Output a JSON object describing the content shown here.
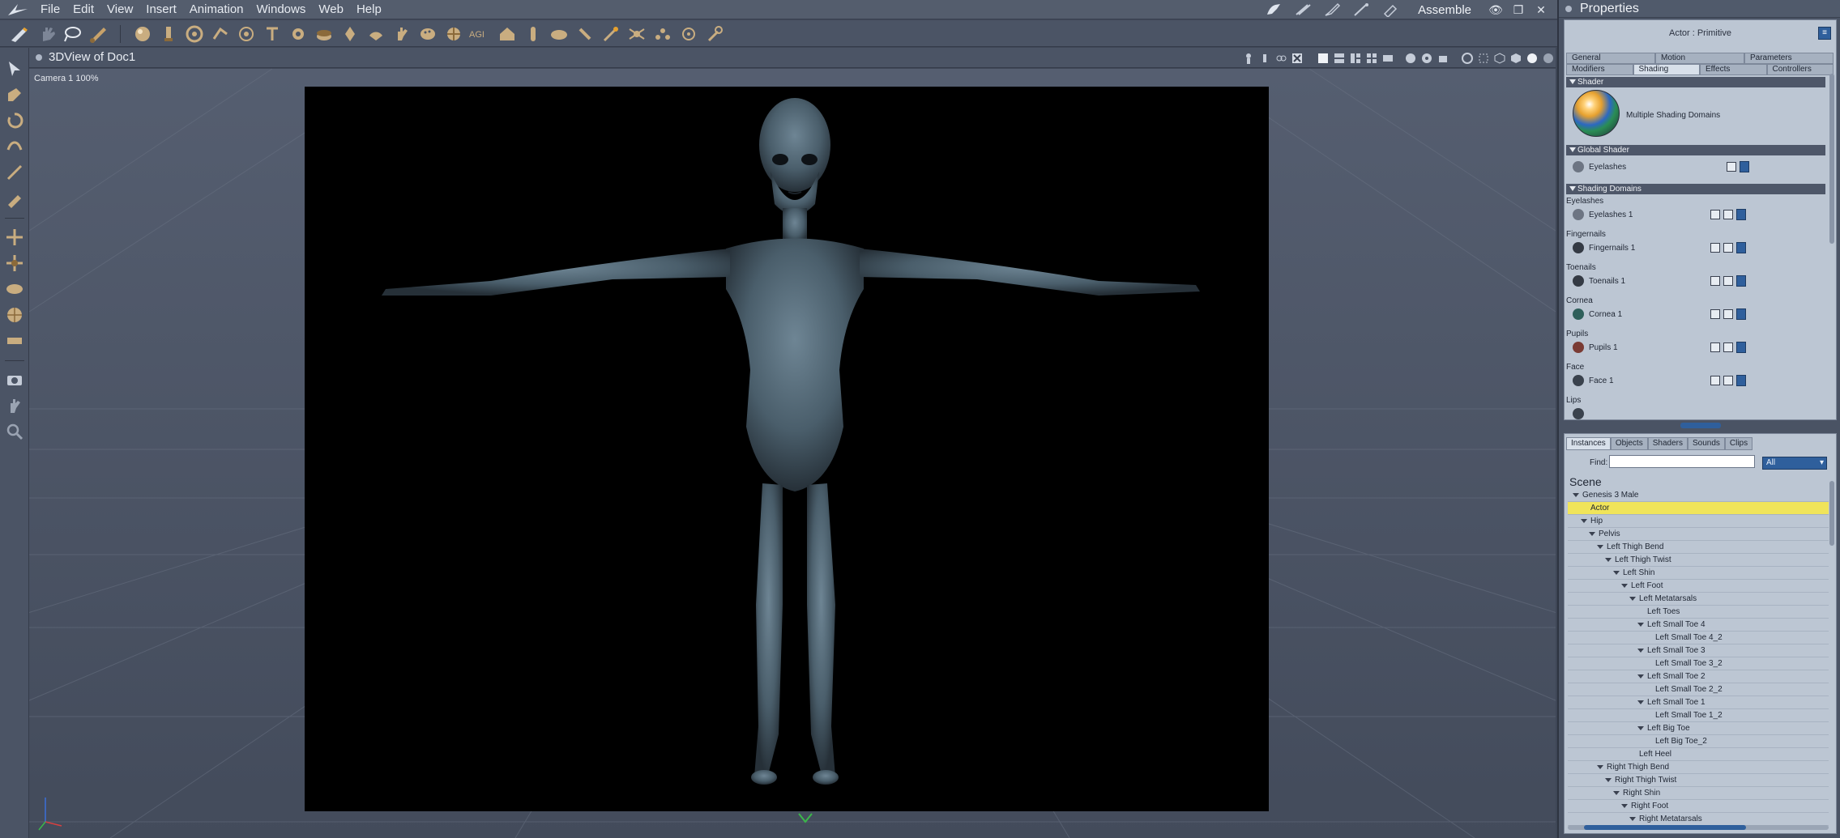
{
  "menubar": {
    "items": [
      "File",
      "Edit",
      "View",
      "Insert",
      "Animation",
      "Windows",
      "Web",
      "Help"
    ],
    "workspace": "Assemble",
    "window_controls": [
      "eye-icon",
      "restore-icon",
      "close-icon"
    ]
  },
  "toolbar": {
    "icons": [
      "pen-icon",
      "hand-icon",
      "lasso-icon",
      "brush-icon",
      "sphere-primitive-icon",
      "light-icon",
      "camera-icon",
      "bone-icon",
      "target-icon",
      "text-icon",
      "gear-icon",
      "cake-icon",
      "cylinder-icon",
      "bulb-icon",
      "hand-icon",
      "palette-icon",
      "creature-icon",
      "agi-icon",
      "house-icon",
      "tube-icon",
      "bowl-icon",
      "pin-icon",
      "wand-icon",
      "spider-icon",
      "chart-icon",
      "target-icon",
      "wrench-icon"
    ]
  },
  "left_tools": {
    "icons": [
      "select-icon",
      "move-icon",
      "rotate-icon",
      "twist-icon",
      "taper-icon",
      "morph-brush-icon",
      "translate-icon",
      "scale-icon",
      "trackball-icon",
      "globe-icon",
      "ruler-icon",
      "camera-icon",
      "hand-icon",
      "magnifier-icon"
    ]
  },
  "view": {
    "title": "3DView of Doc1",
    "camera_label": "Camera 1 100%"
  },
  "properties": {
    "title": "Properties",
    "actor_label": "Actor : Primitive",
    "tabs_row1": [
      "General",
      "Motion",
      "Parameters"
    ],
    "tabs_row2": [
      "Modifiers",
      "Shading",
      "Effects",
      "Controllers"
    ],
    "active_tab": "Shading",
    "shader_section": "Shader",
    "shader_desc": "Multiple Shading Domains",
    "global_section": "Global Shader",
    "global_item": "Eyelashes",
    "domains_section": "Shading Domains",
    "domains": [
      {
        "group": "Eyelashes",
        "item": "Eyelashes 1",
        "color": "#6d7583"
      },
      {
        "group": "Fingernails",
        "item": "Fingernails 1",
        "color": "#343a44"
      },
      {
        "group": "Toenails",
        "item": "Toenails 1",
        "color": "#343a44"
      },
      {
        "group": "Cornea",
        "item": "Cornea 1",
        "color": "#2e5f5a"
      },
      {
        "group": "Pupils",
        "item": "Pupils 1",
        "color": "#7a3b34"
      },
      {
        "group": "Face",
        "item": "Face 1",
        "color": "#3a424d"
      },
      {
        "group": "Lips",
        "item": "",
        "color": "#3a424d"
      }
    ]
  },
  "scene": {
    "tabs": [
      "Instances",
      "Objects",
      "Shaders",
      "Sounds",
      "Clips"
    ],
    "active_tab": "Instances",
    "find_label": "Find:",
    "find_value": "",
    "filter": "All",
    "header": "Scene",
    "rows": [
      {
        "label": "Genesis 3 Male",
        "indent": 0,
        "expand": true,
        "selected": false
      },
      {
        "label": "Actor",
        "indent": 1,
        "expand": false,
        "selected": true
      },
      {
        "label": "Hip",
        "indent": 1,
        "expand": true,
        "selected": false
      },
      {
        "label": "Pelvis",
        "indent": 2,
        "expand": true,
        "selected": false
      },
      {
        "label": "Left Thigh Bend",
        "indent": 3,
        "expand": true,
        "selected": false
      },
      {
        "label": "Left Thigh Twist",
        "indent": 4,
        "expand": true,
        "selected": false
      },
      {
        "label": "Left Shin",
        "indent": 5,
        "expand": true,
        "selected": false
      },
      {
        "label": "Left Foot",
        "indent": 6,
        "expand": true,
        "selected": false
      },
      {
        "label": "Left Metatarsals",
        "indent": 7,
        "expand": true,
        "selected": false
      },
      {
        "label": "Left Toes",
        "indent": 8,
        "expand": false,
        "selected": false
      },
      {
        "label": "Left Small Toe 4",
        "indent": 8,
        "expand": true,
        "selected": false
      },
      {
        "label": "Left Small Toe 4_2",
        "indent": 9,
        "expand": false,
        "selected": false
      },
      {
        "label": "Left Small Toe 3",
        "indent": 8,
        "expand": true,
        "selected": false
      },
      {
        "label": "Left Small Toe 3_2",
        "indent": 9,
        "expand": false,
        "selected": false
      },
      {
        "label": "Left Small Toe 2",
        "indent": 8,
        "expand": true,
        "selected": false
      },
      {
        "label": "Left Small Toe 2_2",
        "indent": 9,
        "expand": false,
        "selected": false
      },
      {
        "label": "Left Small Toe 1",
        "indent": 8,
        "expand": true,
        "selected": false
      },
      {
        "label": "Left Small Toe 1_2",
        "indent": 9,
        "expand": false,
        "selected": false
      },
      {
        "label": "Left Big Toe",
        "indent": 8,
        "expand": true,
        "selected": false
      },
      {
        "label": "Left Big Toe_2",
        "indent": 9,
        "expand": false,
        "selected": false
      },
      {
        "label": "Left Heel",
        "indent": 7,
        "expand": false,
        "selected": false
      },
      {
        "label": "Right Thigh Bend",
        "indent": 3,
        "expand": true,
        "selected": false
      },
      {
        "label": "Right Thigh Twist",
        "indent": 4,
        "expand": true,
        "selected": false
      },
      {
        "label": "Right Shin",
        "indent": 5,
        "expand": true,
        "selected": false
      },
      {
        "label": "Right Foot",
        "indent": 6,
        "expand": true,
        "selected": false
      },
      {
        "label": "Right Metatarsals",
        "indent": 7,
        "expand": true,
        "selected": false
      }
    ]
  }
}
